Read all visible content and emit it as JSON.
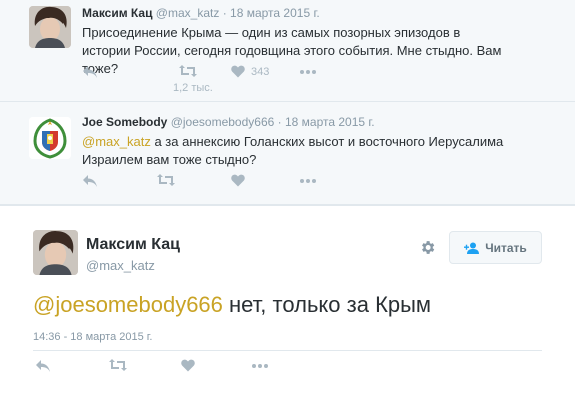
{
  "tweets": [
    {
      "name": "Максим Кац",
      "handle": "@max_katz",
      "date": "18 марта 2015 г.",
      "text": "Присоединение Крыма — один из самых позорных эпизодов в истории России, сегодня годовщина этого события. Мне стыдно. Вам тоже?",
      "likes": "343",
      "retweets": "1,2 тыс.",
      "avatar_icon": "person-portrait"
    },
    {
      "name": "Joe Somebody",
      "handle": "@joesomebody666",
      "date": "18 марта 2015 г.",
      "mention": "@max_katz",
      "text": " а за аннексию Голанских высот и восточного Иерусалима Израилем вам тоже стыдно?",
      "avatar_icon": "coat-of-arms-emblem"
    }
  ],
  "main": {
    "name": "Максим Кац",
    "handle": "@max_katz",
    "mention": "@joesomebody666",
    "text": " нет, только за Крым",
    "timestamp": "14:36 - 18 марта 2015 г.",
    "follow_label": "Читать",
    "avatar_icon": "person-portrait"
  },
  "colors": {
    "mention": "#c9a325",
    "muted": "#8899a6",
    "icon": "#aab8c2",
    "background": "#f5f8fa"
  }
}
